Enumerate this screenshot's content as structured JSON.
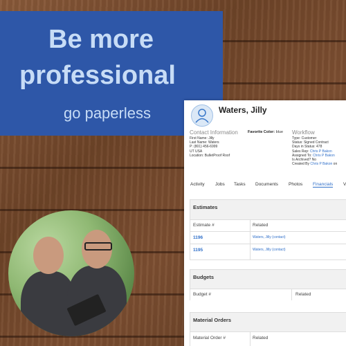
{
  "banner": {
    "line1": "Be more",
    "line2": "professional",
    "line3": "go paperless",
    "bg": "#2e57a8",
    "fg": "#c7dcf6"
  },
  "contact": {
    "name": "Waters, Jilly",
    "contact_info_title": "Contact Information",
    "favorite_color_label": "Favorite Color:",
    "favorite_color_value": "blue",
    "first_name": "First Name: Jilly",
    "last_name": "Last Name: Waters",
    "phone": "P: (801) 456-6999",
    "region": "UT USA",
    "location": "Location: BulletProof Roof"
  },
  "workflow": {
    "title": "Workflow",
    "type": "Type: Customer",
    "status": "Status: Signed Contract",
    "days": "Days in Status: 478",
    "sales_rep_label": "Sales Rep:",
    "sales_rep": "Chris P Bakon",
    "assigned_label": "Assigned To:",
    "assigned": "Chris P Bakon",
    "archived": "Is Archived? No",
    "created_label": "Created By",
    "created": "Chris P Bakon",
    "created_suffix": "on"
  },
  "tabs": [
    "Activity",
    "Jobs",
    "Tasks",
    "Documents",
    "Photos",
    "Financials",
    "V"
  ],
  "estimates": {
    "title": "Estimates",
    "col1": "Estimate #",
    "col2": "Related",
    "rows": [
      {
        "num": "1196",
        "related": "Waters, Jilly (contact)"
      },
      {
        "num": "1195",
        "related": "Waters, Jilly (contact)"
      }
    ]
  },
  "budgets": {
    "title": "Budgets",
    "col1": "Budget #",
    "col2": "Related"
  },
  "material_orders": {
    "title": "Material Orders",
    "col1": "Material Order #",
    "col2": "Related"
  },
  "icons": {
    "avatar": "user-icon"
  }
}
